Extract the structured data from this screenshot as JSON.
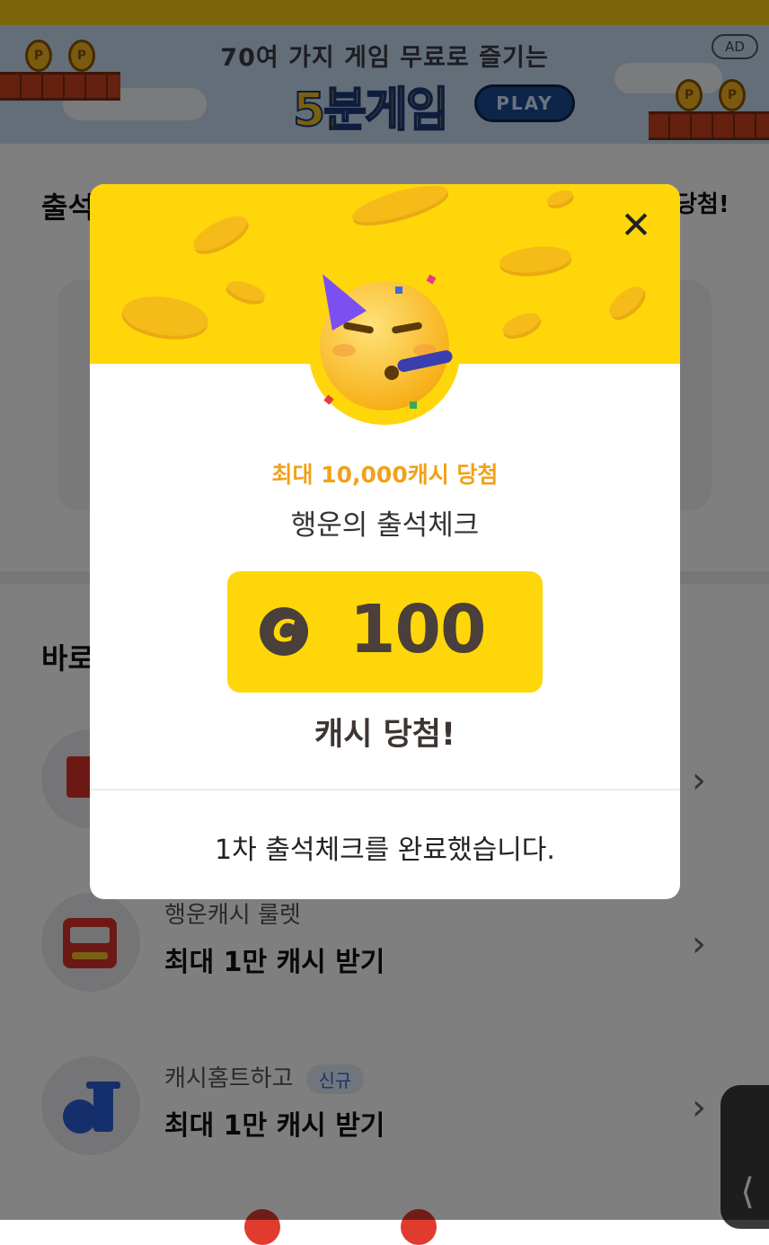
{
  "ad": {
    "headline": "70여 가지 게임 무료로 즐기는",
    "brand": "5분게임",
    "play_label": "PLAY",
    "badge": "AD",
    "coin_letter": "P"
  },
  "page": {
    "attendance_title": "출석",
    "attendance_right": "당첨!",
    "shortcut_title": "바로"
  },
  "list": [
    {
      "sub": "",
      "main": "",
      "tag": ""
    },
    {
      "sub": "행운캐시 룰렛",
      "main": "최대 1만 캐시 받기",
      "tag": ""
    },
    {
      "sub": "캐시홈트하고",
      "main": "최대 1만 캐시 받기",
      "tag": "신규"
    }
  ],
  "chevron": "›",
  "side_tab_label": "⟨",
  "modal": {
    "close_label": "✕",
    "subtitle": "최대 10,000캐시 당첨",
    "title": "행운의 출석체크",
    "cash_symbol": "C",
    "cash_amount": "100",
    "win_label": "캐시 당첨!",
    "done_message": "1차 출석체크를 완료했습니다."
  },
  "icons": {
    "close": "close-icon",
    "cash": "cash-coin-icon",
    "emoji": "party-face-icon",
    "chevron": "chevron-right-icon"
  },
  "colors": {
    "accent_yellow": "#ffd60a",
    "subtitle_orange": "#f0a21a",
    "tag_blue": "#2d6ad6"
  }
}
